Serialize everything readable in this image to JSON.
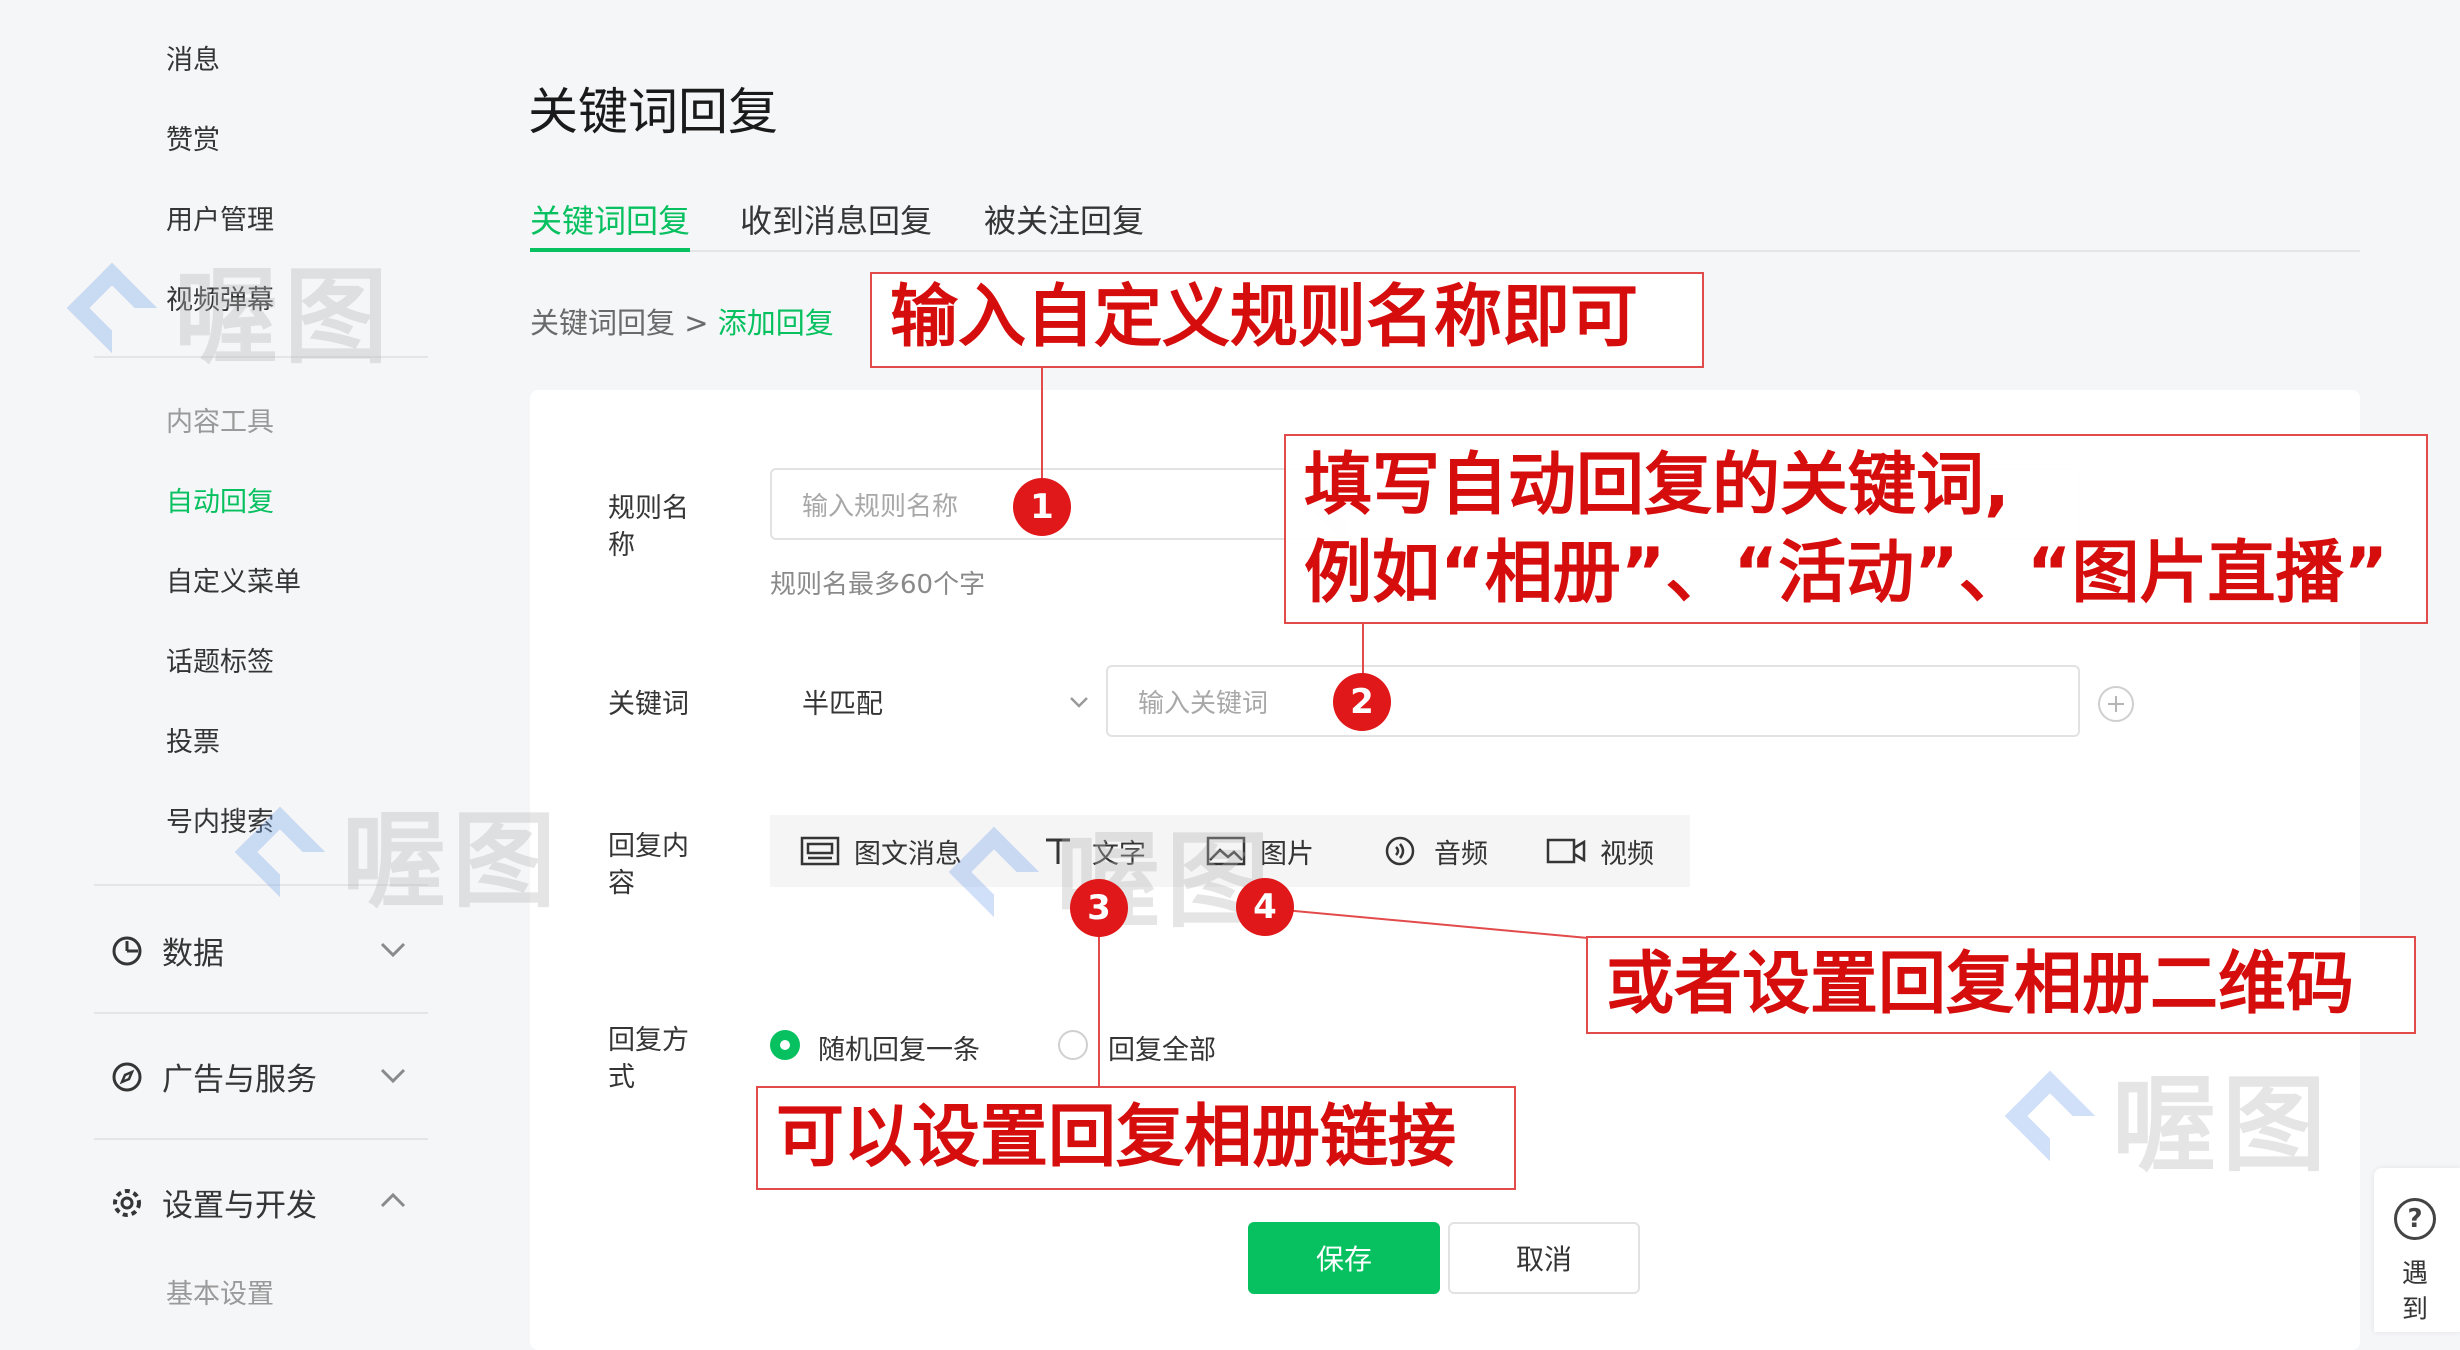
{
  "sidebar": {
    "items": [
      "消息",
      "赞赏",
      "用户管理",
      "视频弹幕"
    ],
    "content_tools": {
      "header": "内容工具",
      "items": [
        "自动回复",
        "自定义菜单",
        "话题标签",
        "投票",
        "号内搜索"
      ],
      "active": "自动回复"
    },
    "groups": [
      {
        "label": "数据",
        "icon": "clock-icon",
        "state": "collapsed"
      },
      {
        "label": "广告与服务",
        "icon": "compass-icon",
        "state": "collapsed"
      },
      {
        "label": "设置与开发",
        "icon": "gear-icon",
        "state": "expanded"
      }
    ],
    "settings_sub": "基本设置"
  },
  "page": {
    "title": "关键词回复",
    "tabs": [
      "关键词回复",
      "收到消息回复",
      "被关注回复"
    ],
    "active_tab": "关键词回复",
    "breadcrumb": {
      "parent": "关键词回复",
      "sep": ">",
      "current": "添加回复"
    }
  },
  "form": {
    "rule_name": {
      "label": "规则名称",
      "placeholder": "输入规则名称",
      "hint": "规则名最多60个字"
    },
    "keyword": {
      "label": "关键词",
      "match_mode": "半匹配",
      "placeholder": "输入关键词"
    },
    "reply_content": {
      "label": "回复内容",
      "types": [
        {
          "label": "图文消息",
          "icon": "article-icon"
        },
        {
          "label": "文字",
          "icon": "text-icon"
        },
        {
          "label": "图片",
          "icon": "image-icon"
        },
        {
          "label": "音频",
          "icon": "audio-icon"
        },
        {
          "label": "视频",
          "icon": "video-icon"
        }
      ]
    },
    "reply_mode": {
      "label": "回复方式",
      "options": [
        {
          "label": "随机回复一条",
          "selected": true
        },
        {
          "label": "回复全部",
          "selected": false
        }
      ]
    },
    "save_label": "保存",
    "cancel_label": "取消"
  },
  "annotations": {
    "a1": "输入自定义规则名称即可",
    "a2_line1": "填写自动回复的关键词,",
    "a2_line2": "例如“相册”、“活动”、“图片直播”",
    "a3": "可以设置回复相册链接",
    "a4": "或者设置回复相册二维码",
    "markers": [
      "1",
      "2",
      "3",
      "4"
    ]
  },
  "watermark_text": "喔图",
  "float_help": {
    "label": "遇到"
  },
  "colors": {
    "accent": "#07c160",
    "annotation": "#d60d0d",
    "marker": "#e0181a"
  }
}
